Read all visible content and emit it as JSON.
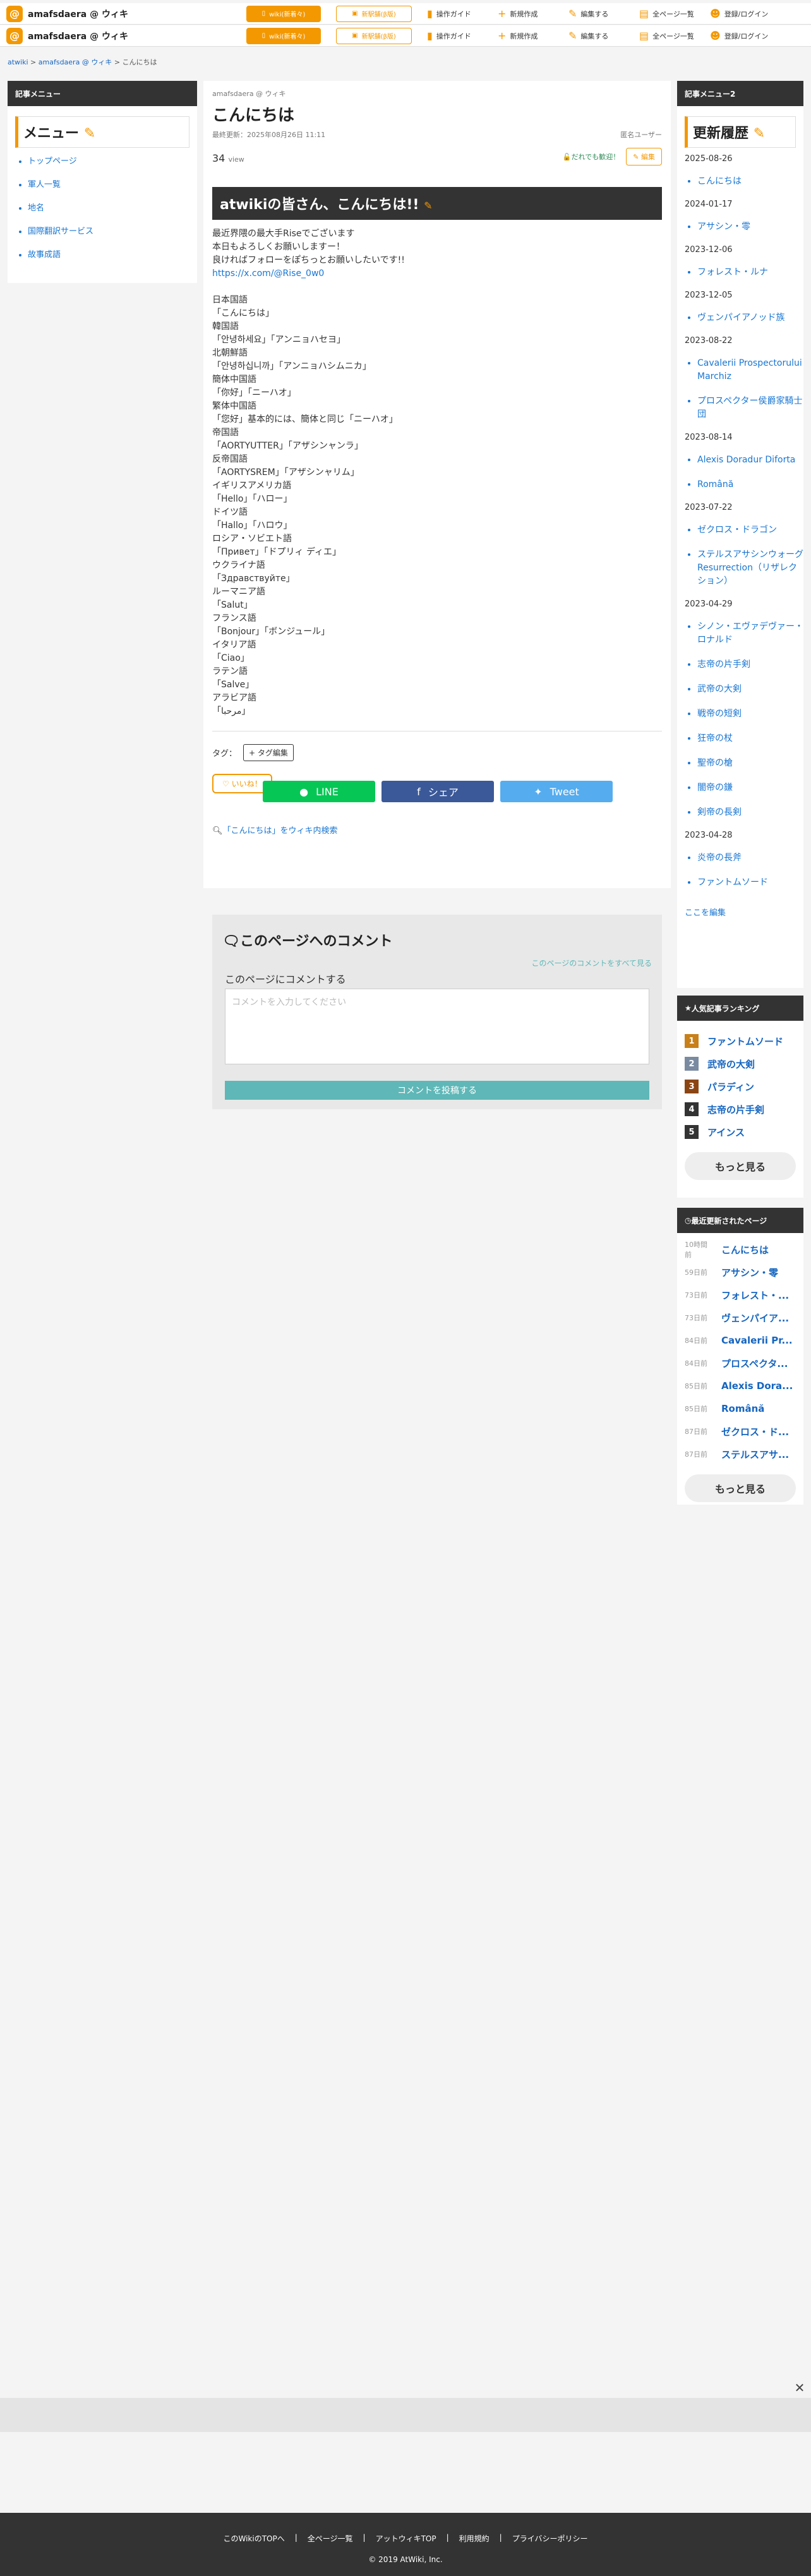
{
  "header": {
    "site": "amafsdaera @ ウィキ",
    "logo_char": "@",
    "wiki_btn": "wiki(新着々)",
    "shop_btn": "新駅舗(β版)",
    "nav": [
      "操作ガイド",
      "新規作成",
      "編集する",
      "全ページ一覧",
      "登録/ログイン"
    ]
  },
  "breadcrumb": {
    "items": [
      "atwiki",
      "amafsdaera @ ウィキ",
      "こんにちは"
    ]
  },
  "left": {
    "title": "記事メニュー",
    "menu_title": "メニュー",
    "items": [
      "トップページ",
      "軍人一覧",
      "地名",
      "国際翻訳サービス",
      "故事成語"
    ]
  },
  "article": {
    "site": "amafsdaera @ ウィキ",
    "title": "こんにちは",
    "updated": "最終更新：2025年08月26日 11:11",
    "author": "匿名ユーザー",
    "views": "34",
    "view_label": "view",
    "anyone": "だれでも歓迎！",
    "edit": "編集",
    "heading": "atwikiの皆さん、こんにちは!!",
    "lines": [
      "最近界隈の最大手Riseでございます",
      "本日もよろしくお願いしますー！",
      "良ければフォローをぽちっとお願いしたいです!!",
      "https://x.com/@Rise_0w0",
      "",
      "日本国語",
      "「こんにちは」",
      "韓国語",
      "「안녕하세요」「アンニョハセヨ」",
      "北朝鮮語",
      "「안녕하십니까」「アンニョハシムニカ」",
      "簡体中国語",
      "「你好」「ニーハオ」",
      "繁体中国語",
      "「您好」基本的には、簡体と同じ「ニーハオ」",
      "帝国語",
      "「AORTYUTTER」「アザシンャンラ」",
      "反帝国語",
      "「AORTYSREM」「アザシンャリム」",
      "イギリスアメリカ語",
      "「Hello」「ハロー」",
      "ドイツ語",
      "「Hallo」「ハロウ」",
      "ロシア・ソビエト語",
      "「Привет」「ドプリィ ディエ」",
      "ウクライナ語",
      "「Здравствуйте」",
      "ルーマニア語",
      "「Salut」",
      "フランス語",
      "「Bonjour」「ボンジュール」",
      "イタリア語",
      "「Ciao」",
      "ラテン語",
      "「Salve」",
      "アラビア語",
      "「مرحبا」"
    ],
    "tag_label": "タグ：",
    "tag_btn": "+ タグ編集",
    "like": "いいね！",
    "search": "「こんにちは」をウィキ内検索"
  },
  "share": {
    "line": "LINE",
    "fb": "シェア",
    "tw": "Tweet"
  },
  "comments": {
    "title": "このページへのコメント",
    "see_all": "このページのコメントをすべて見る",
    "label": "このページにコメントする",
    "placeholder": "コメントを入力してください",
    "submit": "コメントを投稿する"
  },
  "right": {
    "title": "記事メニュー2",
    "hist_title": "更新履歴",
    "history": [
      {
        "date": "2025-08-26",
        "items": [
          "こんにちは"
        ]
      },
      {
        "date": "2024-01-17",
        "items": [
          "アサシン・零"
        ]
      },
      {
        "date": "2023-12-06",
        "items": [
          "フォレスト・ルナ"
        ]
      },
      {
        "date": "2023-12-05",
        "items": [
          "ヴェンパイアノッド族"
        ]
      },
      {
        "date": "2023-08-22",
        "items": [
          "Cavalerii Prospectorului Marchiz",
          "プロスペクター侯爵家騎士団"
        ]
      },
      {
        "date": "2023-08-14",
        "items": [
          "Alexis Doradur Diforta",
          "Română"
        ]
      },
      {
        "date": "2023-07-22",
        "items": [
          "ゼクロス・ドラゴン",
          "ステルスアサシンウォーグResurrection（リザレクション）"
        ]
      },
      {
        "date": "2023-04-29",
        "items": [
          "シノン・エヴァデヴァー・ロナルド",
          "志帝の片手剣",
          "武帝の大剣",
          "戦帝の短剣",
          "狂帝の杖",
          "聖帝の槍",
          "闇帝の鎌",
          "剣帝の長剣"
        ]
      },
      {
        "date": "2023-04-28",
        "items": [
          "炎帝の長斧",
          "ファントムソード"
        ]
      }
    ],
    "edit_link": "ここを編集",
    "rank_title": "人気記事ランキング",
    "ranking": [
      "ファントムソード",
      "武帝の大剣",
      "パラディン",
      "志帝の片手剣",
      "アインス"
    ],
    "more": "もっと見る",
    "recent_title": "最近更新されたページ",
    "recent": [
      {
        "ago": "10時間前",
        "name": "こんにちは"
      },
      {
        "ago": "59日前",
        "name": "アサシン・零"
      },
      {
        "ago": "73日前",
        "name": "フォレスト・..."
      },
      {
        "ago": "73日前",
        "name": "ヴェンパイア..."
      },
      {
        "ago": "84日前",
        "name": "Cavalerii Pr..."
      },
      {
        "ago": "84日前",
        "name": "プロスペクタ..."
      },
      {
        "ago": "85日前",
        "name": "Alexis Dora..."
      },
      {
        "ago": "85日前",
        "name": "Română"
      },
      {
        "ago": "87日前",
        "name": "ゼクロス・ド..."
      },
      {
        "ago": "87日前",
        "name": "ステルスアサ..."
      }
    ]
  },
  "footer": {
    "links": [
      "このWikiのTOPへ",
      "全ページ一覧",
      "アットウィキTOP",
      "利用規約",
      "プライバシーポリシー"
    ],
    "copy": "2019 AtWiki, Inc."
  },
  "colors": {
    "accent": "#f39800",
    "dark": "#333333",
    "line": "#06c755",
    "fb": "#3b5998",
    "tw": "#55acee"
  }
}
